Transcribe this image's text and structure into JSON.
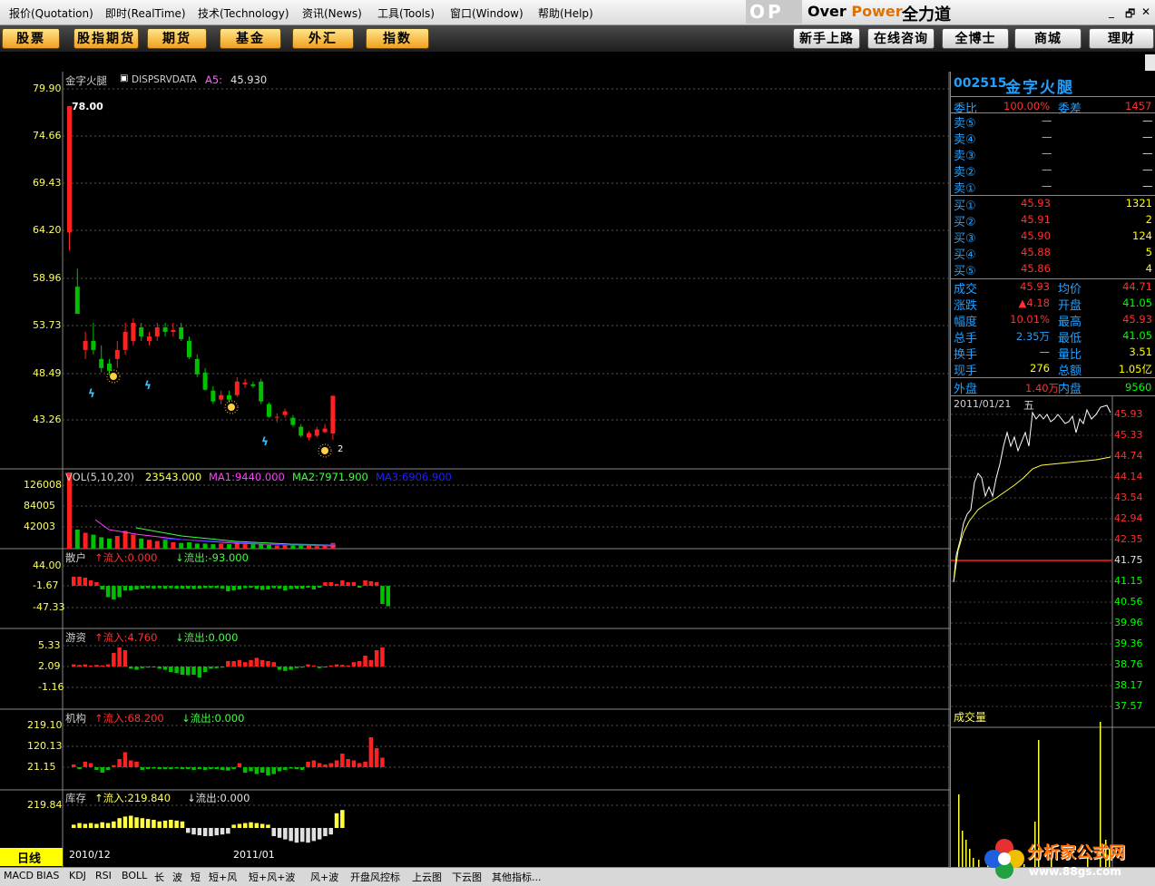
{
  "menu": [
    "报价(Quotation)",
    "即时(RealTime)",
    "技术(Technology)",
    "资讯(News)",
    "工具(Tools)",
    "窗口(Window)",
    "帮助(Help)"
  ],
  "brand": {
    "mark": "OP",
    "over": "Over ",
    "power": "Power",
    "cn": "全力道"
  },
  "window": {
    "min": "_",
    "restore": "🗗",
    "close": "✕"
  },
  "toolbar_left": [
    "股票",
    "股指期货",
    "期货",
    "基金",
    "外汇",
    "指数"
  ],
  "toolbar_right": [
    "新手上路",
    "在线咨询",
    "全博士",
    "商城",
    "理财"
  ],
  "kline": {
    "title": "金字火腿",
    "ind": "DISPSRVDATA",
    "a5_label": "A5:",
    "a5_value": "45.930",
    "high_label": "78.00",
    "y_ticks": [
      "79.90",
      "74.66",
      "69.43",
      "64.20",
      "58.96",
      "53.73",
      "48.49",
      "43.26"
    ],
    "end_label": "2"
  },
  "vol": {
    "label": "VOL(5,10,20)",
    "v": "23543.000",
    "ma1": "MA1:9440.000",
    "ma2": "MA2:7971.900",
    "ma3": "MA3:6906.900",
    "y_ticks": [
      "126008",
      "84005",
      "42003"
    ]
  },
  "sanhu": {
    "name": "散户",
    "inflow": "↑流入:0.000",
    "outflow": "↓流出:-93.000",
    "y_ticks": [
      "44.00",
      "-1.67",
      "-47.33"
    ]
  },
  "youzi": {
    "name": "游资",
    "inflow": "↑流入:4.760",
    "outflow": "↓流出:0.000",
    "y_ticks": [
      "5.33",
      "2.09",
      "-1.16"
    ]
  },
  "jigou": {
    "name": "机构",
    "inflow": "↑流入:68.200",
    "outflow": "↓流出:0.000",
    "y_ticks": [
      "219.10",
      "120.13",
      "21.15"
    ]
  },
  "kucun": {
    "name": "库存",
    "inflow": "↑流入:219.840",
    "outflow": "↓流出:0.000",
    "y_ticks": [
      "219.84"
    ]
  },
  "xaxis": {
    "period": "日线",
    "d1": "2010/12",
    "d2": "2011/01"
  },
  "quote": {
    "code": "002515",
    "name": "金字火腿",
    "weibi": {
      "l": "委比",
      "v": "100.00%",
      "l2": "委差",
      "v2": "1457"
    },
    "sells": [
      {
        "l": "卖⑤",
        "p": "—",
        "q": "—"
      },
      {
        "l": "卖④",
        "p": "—",
        "q": "—"
      },
      {
        "l": "卖③",
        "p": "—",
        "q": "—"
      },
      {
        "l": "卖②",
        "p": "—",
        "q": "—"
      },
      {
        "l": "卖①",
        "p": "—",
        "q": "—"
      }
    ],
    "buys": [
      {
        "l": "买①",
        "p": "45.93",
        "q": "1321"
      },
      {
        "l": "买②",
        "p": "45.91",
        "q": "2"
      },
      {
        "l": "买③",
        "p": "45.90",
        "q": "124"
      },
      {
        "l": "买④",
        "p": "45.88",
        "q": "5"
      },
      {
        "l": "买⑤",
        "p": "45.86",
        "q": "4"
      }
    ],
    "stats": [
      {
        "l": "成交",
        "v": "45.93",
        "l2": "均价",
        "v2": "44.71"
      },
      {
        "l": "涨跌",
        "v": "▲4.18",
        "l2": "开盘",
        "v2": "41.05"
      },
      {
        "l": "幅度",
        "v": "10.01%",
        "l2": "最高",
        "v2": "45.93"
      },
      {
        "l": "总手",
        "v": "2.35万",
        "l2": "最低",
        "v2": "41.05"
      },
      {
        "l": "换手",
        "v": "—",
        "l2": "量比",
        "v2": "3.51"
      },
      {
        "l": "现手",
        "v": "276",
        "l2": "总额",
        "v2": "1.05亿"
      }
    ],
    "waipan": {
      "l": "外盘",
      "v": "1.40万",
      "l2": "内盘",
      "v2": "9560"
    }
  },
  "intraday": {
    "date": "2011/01/21",
    "weekday": "五",
    "y_ticks": [
      "45.93",
      "45.33",
      "44.74",
      "44.14",
      "43.54",
      "42.94",
      "42.35",
      "41.75",
      "41.15",
      "40.56",
      "39.96",
      "39.36",
      "38.76",
      "38.17",
      "37.57"
    ],
    "vol_label": "成交量",
    "bi": "笔"
  },
  "tabs": [
    "MACD",
    "BIAS",
    "KDJ",
    "RSI",
    "BOLL",
    "长",
    "波",
    "短",
    "短+风",
    "短+风+波",
    "风+波",
    "开盘风控标",
    "上云图",
    "下云图",
    "其他指标..."
  ],
  "logo": {
    "name": "分析家公式网",
    "url": "www.88gs.com"
  },
  "colors": {
    "up": "#ff2020",
    "down": "#00c000",
    "label": "#ffff60",
    "blue": "#20a0ff"
  }
}
